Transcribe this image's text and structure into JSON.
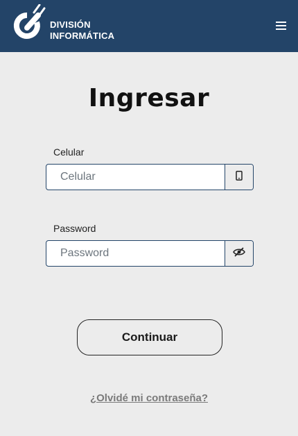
{
  "header": {
    "brand_line1": "DIVISIÓN",
    "brand_line2": "INFORMÁTICA",
    "logo_icon": "power-plug-icon",
    "menu_icon": "hamburger-menu-icon",
    "background_color": "#234468"
  },
  "main": {
    "title": "Ingresar",
    "phone": {
      "label": "Celular",
      "placeholder": "Celular",
      "value": "",
      "icon": "mobile-phone-icon"
    },
    "password": {
      "label": "Password",
      "placeholder": "Password",
      "value": "",
      "icon": "eye-slash-icon"
    },
    "continue_label": "Continuar",
    "forgot_label": "¿Olvidé mi contraseña?"
  }
}
